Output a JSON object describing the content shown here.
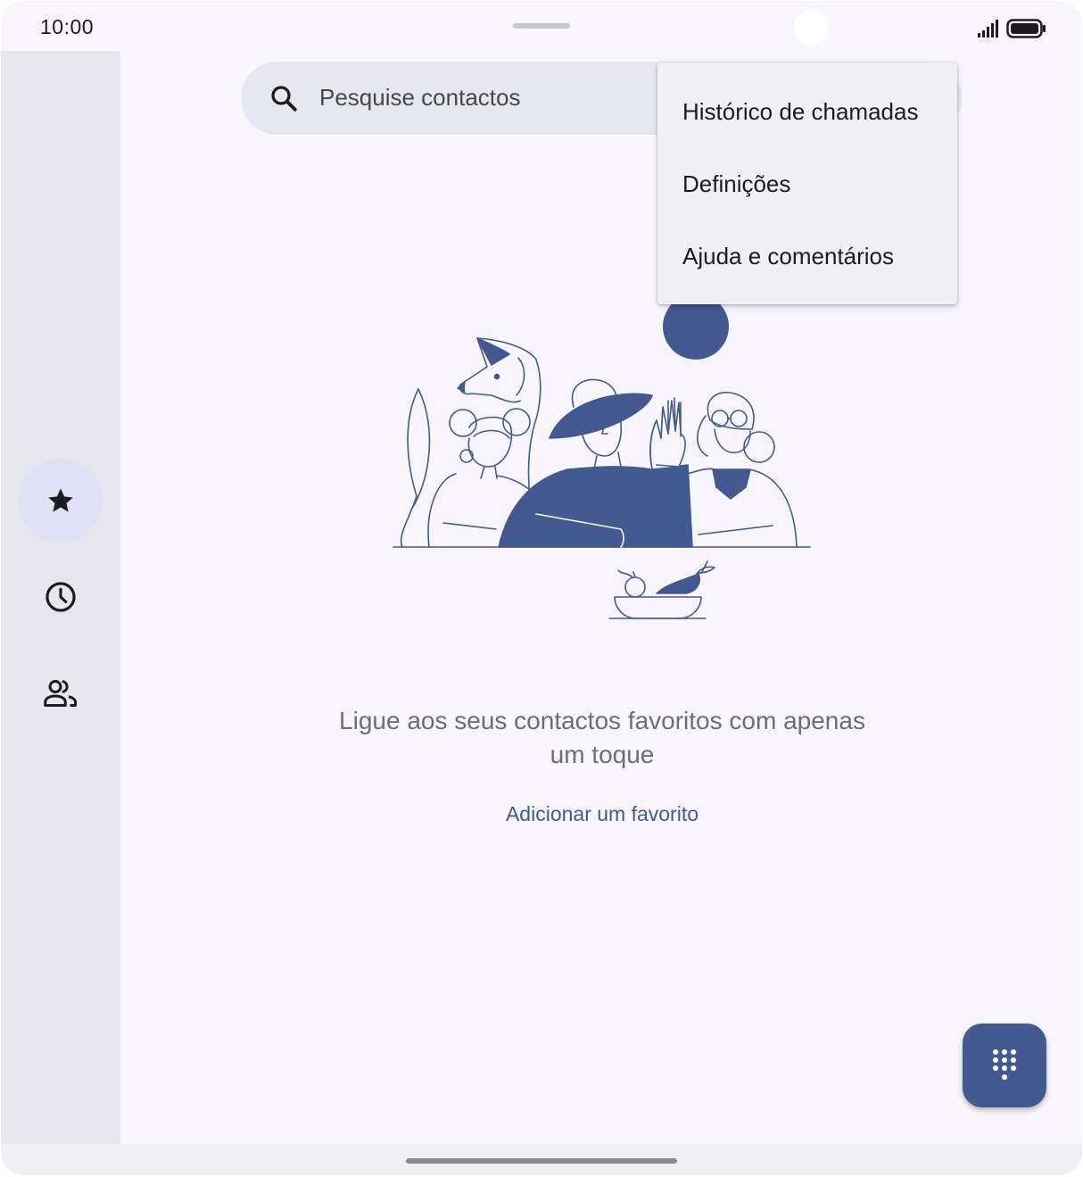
{
  "status_bar": {
    "time": "10:00",
    "signal_icon": "cellular-signal-icon",
    "battery_icon": "battery-full-icon"
  },
  "navigation_rail": {
    "items": [
      {
        "name": "favorites",
        "icon": "star-icon",
        "active": true
      },
      {
        "name": "recents",
        "icon": "clock-icon",
        "active": false
      },
      {
        "name": "contacts",
        "icon": "people-icon",
        "active": false
      }
    ]
  },
  "search": {
    "placeholder": "Pesquise contactos",
    "icon": "search-icon"
  },
  "overflow_menu": {
    "items": [
      {
        "label": "Histórico de chamadas"
      },
      {
        "label": "Definições"
      },
      {
        "label": "Ajuda e comentários"
      }
    ]
  },
  "empty_state": {
    "illustration": "people-and-pets-illustration",
    "message": "Ligue aos seus contactos favoritos com apenas um toque",
    "action": "Adicionar um favorito"
  },
  "fab": {
    "icon": "dialpad-icon"
  },
  "colors": {
    "accent": "#43598f",
    "illustration": "#43598f",
    "rail_background": "#e8e6ee",
    "active_indicator": "#dde2f5",
    "surface": "#f8f6fc",
    "menu_surface": "#f0eff4"
  }
}
